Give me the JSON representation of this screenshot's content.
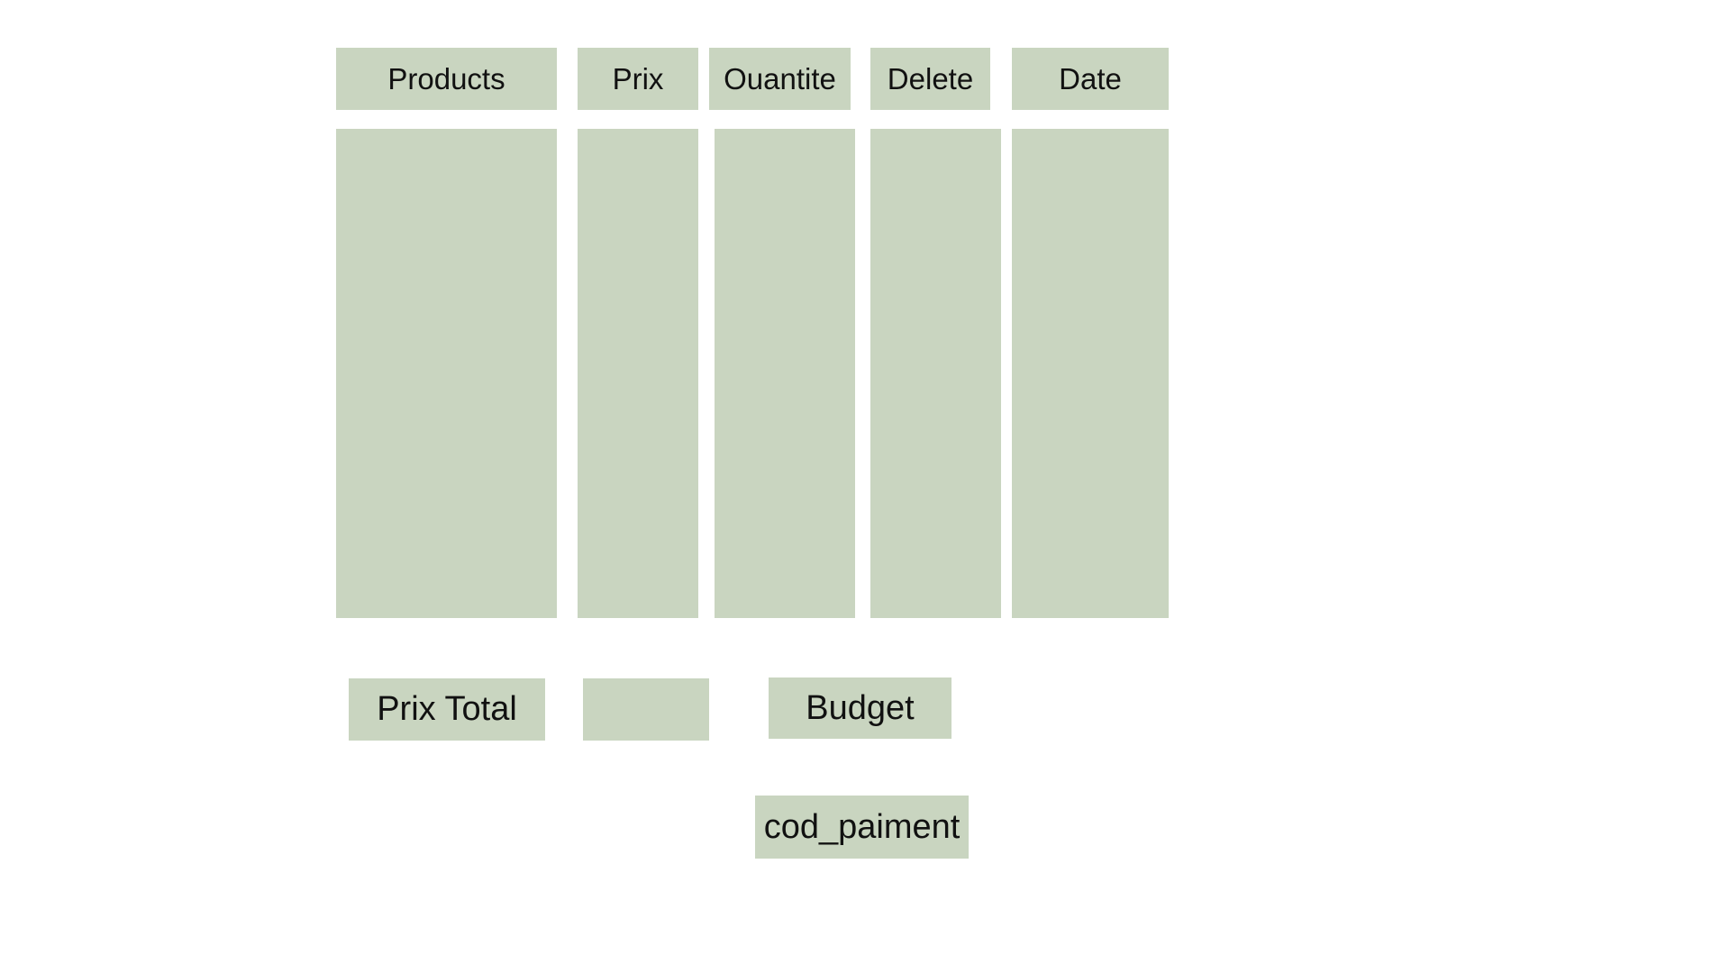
{
  "table": {
    "headers": {
      "products": "Products",
      "prix": "Prix",
      "quantite": "Ouantite",
      "delete": "Delete",
      "date": "Date"
    },
    "rows": []
  },
  "summary": {
    "prix_total_label": "Prix Total",
    "prix_total_value": "",
    "budget_label": "Budget",
    "cod_paiment_label": "cod_paiment"
  },
  "colors": {
    "cell_background": "#c9d5c0",
    "page_background": "#ffffff",
    "text": "#111111"
  }
}
